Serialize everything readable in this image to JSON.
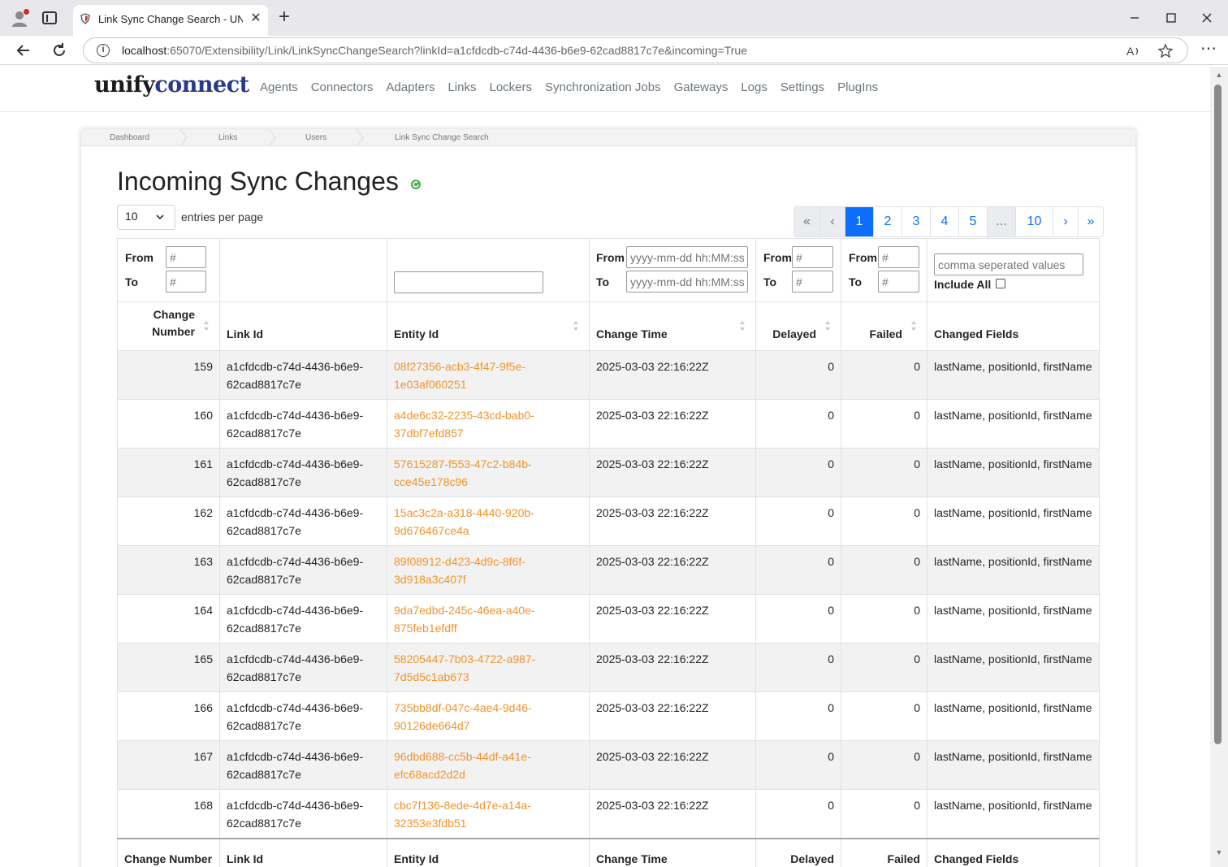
{
  "browser": {
    "tab_title": "Link Sync Change Search - UNIFYCONNECT",
    "tab_close": "✕",
    "new_tab": "+",
    "url_host": "localhost",
    "url_path": ":65070/Extensibility/Link/LinkSyncChangeSearch?linkId=a1cfdcdb-c74d-4436-b6e9-62cad8817c7e&incoming=True",
    "icons": [
      "profile-icon",
      "tabs-icon",
      "back-icon",
      "refresh-icon",
      "info-icon",
      "read-aloud-icon",
      "favorite-star-icon",
      "more-icon",
      "minimize-icon",
      "maximize-icon",
      "close-icon"
    ]
  },
  "app": {
    "logo_part1": "unify",
    "logo_part2": "connect",
    "nav": [
      "Agents",
      "Connectors",
      "Adapters",
      "Links",
      "Lockers",
      "Synchronization Jobs",
      "Gateways",
      "Logs",
      "Settings",
      "PlugIns"
    ]
  },
  "breadcrumb": [
    "Dashboard",
    "Links",
    "Users",
    "Link Sync Change Search"
  ],
  "page": {
    "title": "Incoming Sync Changes",
    "per_page_value": "10",
    "per_page_label": "entries per page"
  },
  "pagination": {
    "items": [
      "«",
      "‹",
      "1",
      "2",
      "3",
      "4",
      "5",
      "...",
      "10",
      "›",
      "»"
    ],
    "current": "1"
  },
  "filters": {
    "from": "From",
    "to": "To",
    "number_placeholder": "#",
    "date_placeholder": "yyyy-mm-dd hh:MM:ss",
    "fields_placeholder": "comma seperated values",
    "include_all": "Include All"
  },
  "table": {
    "columns": [
      "Change Number",
      "Link Id",
      "Entity Id",
      "Change Time",
      "Delayed",
      "Failed",
      "Changed Fields"
    ],
    "header_change_number_l1": "Change",
    "header_change_number_l2": "Number",
    "rows": [
      {
        "change": "159",
        "link": "a1cfdcdb-c74d-4436-b6e9-62cad8817c7e",
        "entity": "08f27356-acb3-4f47-9f5e-1e03af060251",
        "time": "2025-03-03 22:16:22Z",
        "delayed": "0",
        "failed": "0",
        "fields": "lastName, positionId, firstName"
      },
      {
        "change": "160",
        "link": "a1cfdcdb-c74d-4436-b6e9-62cad8817c7e",
        "entity": "a4de6c32-2235-43cd-bab0-37dbf7efd857",
        "time": "2025-03-03 22:16:22Z",
        "delayed": "0",
        "failed": "0",
        "fields": "lastName, positionId, firstName"
      },
      {
        "change": "161",
        "link": "a1cfdcdb-c74d-4436-b6e9-62cad8817c7e",
        "entity": "57615287-f553-47c2-b84b-cce45e178c96",
        "time": "2025-03-03 22:16:22Z",
        "delayed": "0",
        "failed": "0",
        "fields": "lastName, positionId, firstName"
      },
      {
        "change": "162",
        "link": "a1cfdcdb-c74d-4436-b6e9-62cad8817c7e",
        "entity": "15ac3c2a-a318-4440-920b-9d676467ce4a",
        "time": "2025-03-03 22:16:22Z",
        "delayed": "0",
        "failed": "0",
        "fields": "lastName, positionId, firstName"
      },
      {
        "change": "163",
        "link": "a1cfdcdb-c74d-4436-b6e9-62cad8817c7e",
        "entity": "89f08912-d423-4d9c-8f6f-3d918a3c407f",
        "time": "2025-03-03 22:16:22Z",
        "delayed": "0",
        "failed": "0",
        "fields": "lastName, positionId, firstName"
      },
      {
        "change": "164",
        "link": "a1cfdcdb-c74d-4436-b6e9-62cad8817c7e",
        "entity": "9da7edbd-245c-46ea-a40e-875feb1efdff",
        "time": "2025-03-03 22:16:22Z",
        "delayed": "0",
        "failed": "0",
        "fields": "lastName, positionId, firstName"
      },
      {
        "change": "165",
        "link": "a1cfdcdb-c74d-4436-b6e9-62cad8817c7e",
        "entity": "58205447-7b03-4722-a987-7d5d5c1ab673",
        "time": "2025-03-03 22:16:22Z",
        "delayed": "0",
        "failed": "0",
        "fields": "lastName, positionId, firstName"
      },
      {
        "change": "166",
        "link": "a1cfdcdb-c74d-4436-b6e9-62cad8817c7e",
        "entity": "735bb8df-047c-4ae4-9d46-90126de664d7",
        "time": "2025-03-03 22:16:22Z",
        "delayed": "0",
        "failed": "0",
        "fields": "lastName, positionId, firstName"
      },
      {
        "change": "167",
        "link": "a1cfdcdb-c74d-4436-b6e9-62cad8817c7e",
        "entity": "96dbd688-cc5b-44df-a41e-efc68acd2d2d",
        "time": "2025-03-03 22:16:22Z",
        "delayed": "0",
        "failed": "0",
        "fields": "lastName, positionId, firstName"
      },
      {
        "change": "168",
        "link": "a1cfdcdb-c74d-4436-b6e9-62cad8817c7e",
        "entity": "cbc7f136-8ede-4d7e-a14a-32353e3fdb51",
        "time": "2025-03-03 22:16:22Z",
        "delayed": "0",
        "failed": "0",
        "fields": "lastName, positionId, firstName"
      }
    ]
  },
  "colors": {
    "link_orange": "#f0932b",
    "pager_blue": "#0d6efd",
    "logo_blue": "#2a3a88",
    "row_stripe": "#f2f2f2"
  }
}
